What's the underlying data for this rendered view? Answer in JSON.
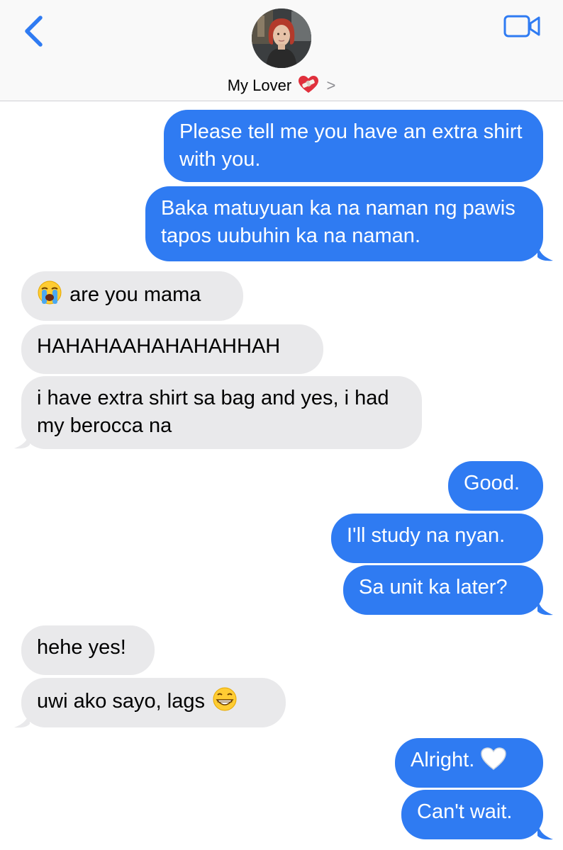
{
  "header": {
    "contact_name": "My Lover",
    "contact_emoji": "heart-with-bandage",
    "chevron": ">"
  },
  "icons": {
    "back": "chevron-left-icon",
    "video": "video-camera-icon"
  },
  "colors": {
    "accent": "#2f7bf2",
    "incoming_bubble": "#e9e9eb",
    "header_bg": "#f9f9f9"
  },
  "messages": [
    {
      "from": "me",
      "text": "Please tell me you have an extra shirt with you."
    },
    {
      "from": "me",
      "text": "Baka matuyuan ka na naman ng pawis tapos uubuhin ka na naman."
    },
    {
      "from": "them",
      "text": "are you mama",
      "emoji": "loudly-crying-face"
    },
    {
      "from": "them",
      "text": "HAHAHAAHAHAHAHHAH"
    },
    {
      "from": "them",
      "text": "i have extra shirt sa bag and yes, i had my berocca na"
    },
    {
      "from": "me",
      "text": "Good."
    },
    {
      "from": "me",
      "text": "I'll study na nyan."
    },
    {
      "from": "me",
      "text": "Sa unit ka later?"
    },
    {
      "from": "them",
      "text": "hehe yes!"
    },
    {
      "from": "them",
      "text": "uwi ako sayo, lags",
      "emoji": "grinning-face"
    },
    {
      "from": "me",
      "text": "Alright.",
      "emoji": "white-heart"
    },
    {
      "from": "me",
      "text": "Can't wait."
    }
  ]
}
